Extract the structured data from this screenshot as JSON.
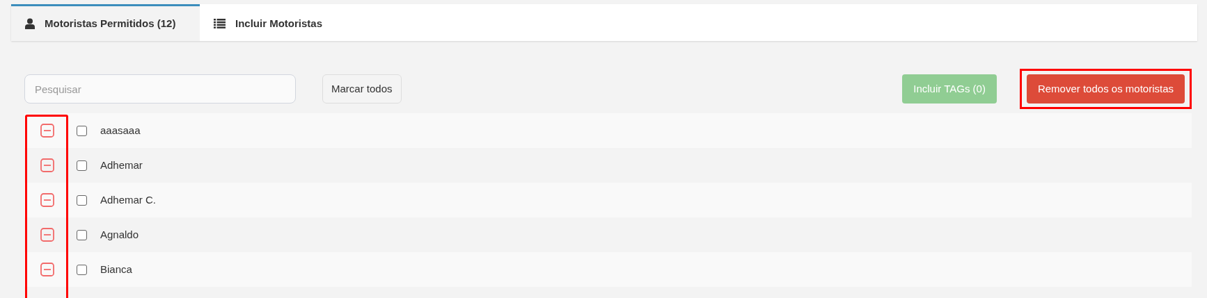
{
  "tabs": [
    {
      "label": "Motoristas Permitidos (12)",
      "kind": "user",
      "selected": true
    },
    {
      "label": "Incluir Motoristas",
      "kind": "list",
      "selected": false
    }
  ],
  "search": {
    "placeholder": "Pesquisar"
  },
  "mark_all_button": "Marcar todos",
  "include_tags_button": {
    "label": "Incluir TAGs (0)",
    "disabled": true
  },
  "remove_all_button": "Remover todos os motoristas",
  "drivers": [
    {
      "name": "aaasaaa",
      "checked": false
    },
    {
      "name": "Adhemar",
      "checked": false
    },
    {
      "name": "Adhemar C.",
      "checked": false
    },
    {
      "name": "Agnaldo",
      "checked": false
    },
    {
      "name": "Bianca",
      "checked": false
    }
  ]
}
